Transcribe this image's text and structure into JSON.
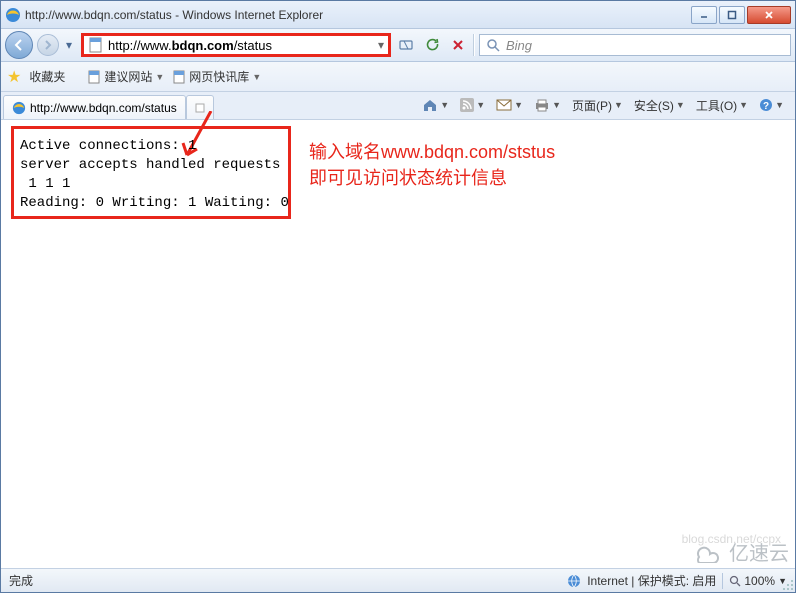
{
  "title": "http://www.bdqn.com/status - Windows Internet Explorer",
  "url_display_prefix": "http://www.",
  "url_display_bold": "bdqn.com",
  "url_display_suffix": "/status",
  "search": {
    "placeholder": "Bing"
  },
  "favbar": {
    "label": "收藏夹",
    "items": [
      "建议网站",
      "网页快讯库"
    ]
  },
  "tab": {
    "label": "http://www.bdqn.com/status"
  },
  "toolbar": {
    "page": "页面(P)",
    "safety": "安全(S)",
    "tools": "工具(O)"
  },
  "page_content": {
    "line1": "Active connections: 1",
    "line2": "server accepts handled requests",
    "line3": " 1 1 1",
    "line4": "Reading: 0 Writing: 1 Waiting: 0"
  },
  "annotation": {
    "l1": "输入域名www.bdqn.com/ststus",
    "l2": "即可见访问状态统计信息"
  },
  "status": {
    "done": "完成",
    "zone": "Internet | 保护模式: 启用",
    "zoom": "100%"
  },
  "watermark": "blog.csdn.net/ccpx",
  "logo": "亿速云"
}
